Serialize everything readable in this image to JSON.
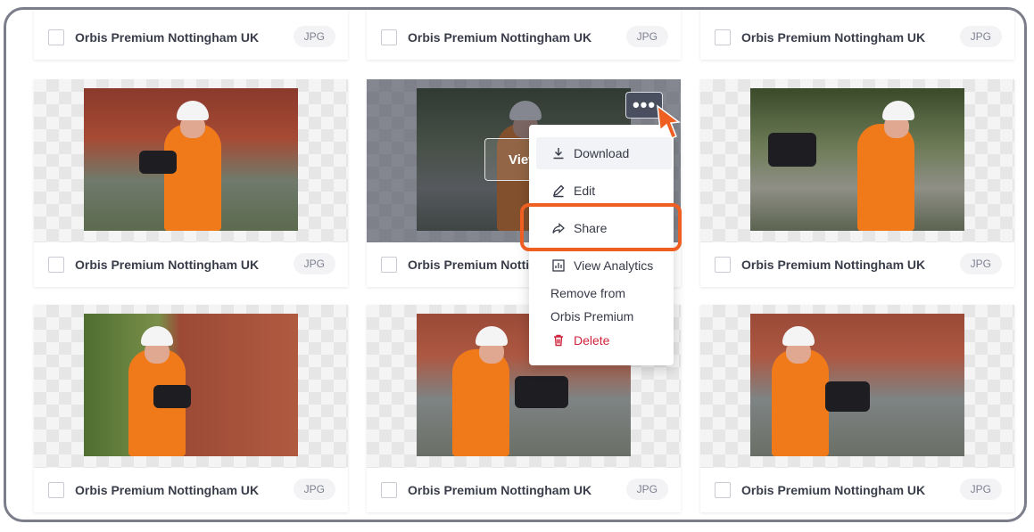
{
  "file_name": "Orbis Premium Nottingham UK",
  "file_type": "JPG",
  "view_label": "View",
  "more_label": "•••",
  "menu": {
    "download": "Download",
    "edit": "Edit",
    "share": "Share",
    "analytics": "View Analytics",
    "remove_line1": "Remove from",
    "remove_line2": "Orbis Premium",
    "delete": "Delete"
  },
  "colors": {
    "accent_orange": "#ee5f21",
    "delete_red": "#d0243d"
  },
  "icons": {
    "download": "download-icon",
    "edit": "pencil-icon",
    "share": "share-arrow-icon",
    "analytics": "chart-icon",
    "delete": "trash-icon"
  }
}
